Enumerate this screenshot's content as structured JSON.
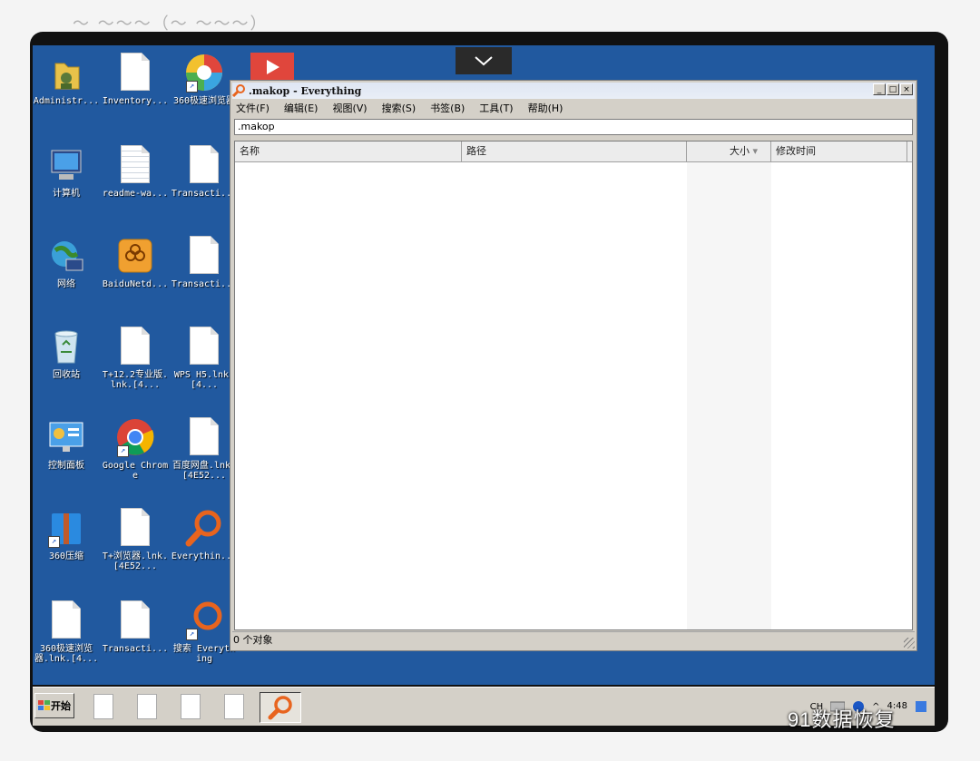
{
  "top_caption": "～ ～～～（～ ～～～）",
  "desktop": {
    "icons": [
      {
        "label": "Administr..."
      },
      {
        "label": "Inventory..."
      },
      {
        "label": "360极速浏览器"
      },
      {
        "label": "计算机"
      },
      {
        "label": "readme-wa..."
      },
      {
        "label": "Transacti..."
      },
      {
        "label": "网络"
      },
      {
        "label": "BaiduNetd..."
      },
      {
        "label": "Transacti..."
      },
      {
        "label": "回收站"
      },
      {
        "label": "T+12.2专业版.lnk.[4..."
      },
      {
        "label": "WPS H5.lnk.[4..."
      },
      {
        "label": "控制面板"
      },
      {
        "label": "Google Chrome"
      },
      {
        "label": "百度网盘.lnk.[4E52..."
      },
      {
        "label": "360压缩"
      },
      {
        "label": "T+浏览器.lnk.[4E52..."
      },
      {
        "label": "Everythin..."
      },
      {
        "label": "360极速浏览器.lnk.[4..."
      },
      {
        "label": "Transacti..."
      },
      {
        "label": "搜索 Everything"
      }
    ]
  },
  "window": {
    "title": ".makop - Everything",
    "controls": {
      "minimize": "_",
      "maximize": "□",
      "close": "×"
    },
    "menu": [
      "文件(F)",
      "编辑(E)",
      "视图(V)",
      "搜索(S)",
      "书签(B)",
      "工具(T)",
      "帮助(H)"
    ],
    "search_value": ".makop",
    "columns": {
      "name": "名称",
      "path": "路径",
      "size": "大小",
      "modified": "修改时间"
    },
    "sort_indicator": "▾",
    "status": "0 个对象"
  },
  "taskbar": {
    "start_label": "开始",
    "tray": {
      "lang": "CH",
      "time": "4:48"
    }
  },
  "watermark": "91数据恢复",
  "colors": {
    "desktop": "#21599f",
    "window_chrome": "#d4d0c8",
    "everything_orange": "#e8641e"
  }
}
